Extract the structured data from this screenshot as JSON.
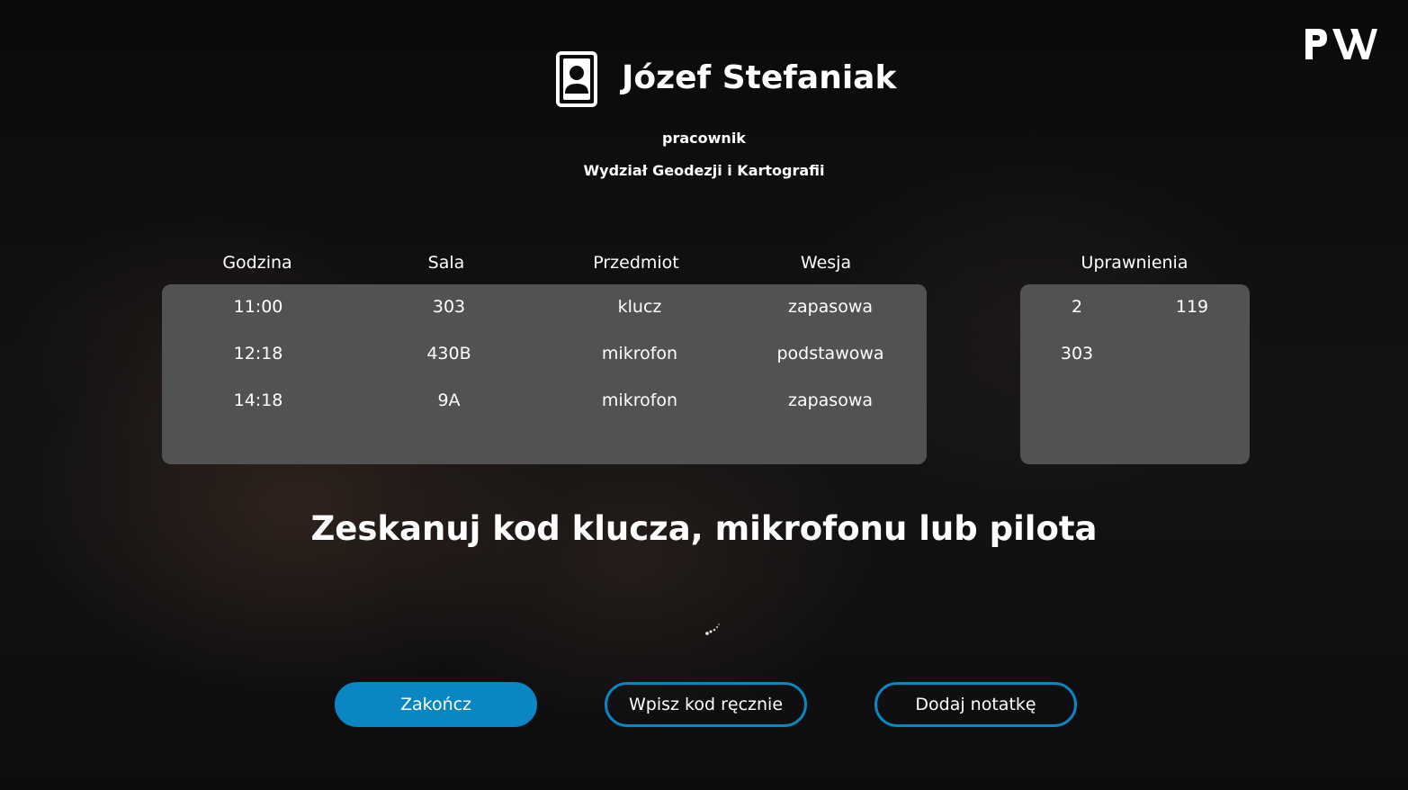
{
  "brand": {
    "logo_text": "PW",
    "accent_color": "#0a86c2"
  },
  "user": {
    "name": "Józef Stefaniak",
    "role": "pracownik",
    "faculty": "Wydział Geodezji i Kartografii"
  },
  "schedule": {
    "headers": [
      "Godzina",
      "Sala",
      "Przedmiot",
      "Wesja"
    ],
    "rows": [
      [
        "11:00",
        "303",
        "klucz",
        "zapasowa"
      ],
      [
        "12:18",
        "430B",
        "mikrofon",
        "podstawowa"
      ],
      [
        "14:18",
        "9A",
        "mikrofon",
        "zapasowa"
      ]
    ]
  },
  "permissions": {
    "header": "Uprawnienia",
    "items": [
      "2",
      "119",
      "303"
    ]
  },
  "prompt": "Zeskanuj kod klucza, mikrofonu lub pilota",
  "buttons": {
    "finish": "Zakończ",
    "manual_code": "Wpisz kod ręcznie",
    "add_note": "Dodaj notatkę"
  },
  "icons": {
    "avatar": "user-avatar-icon",
    "spinner": "loading-spinner-icon"
  }
}
